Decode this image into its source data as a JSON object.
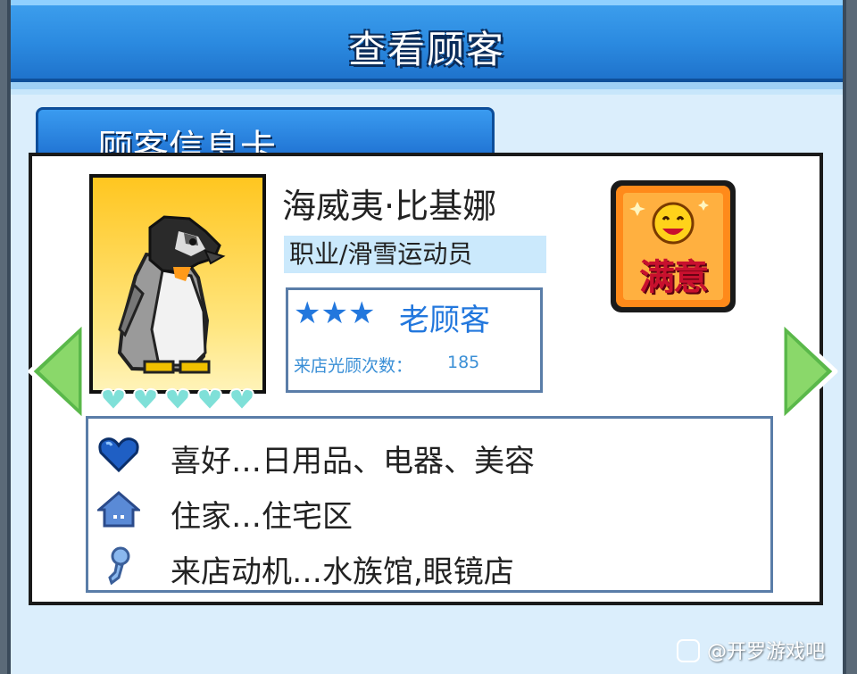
{
  "header": {
    "title": "查看顾客"
  },
  "tab": {
    "label": "顾客信息卡"
  },
  "customer": {
    "name": "海威夷·比基娜",
    "job": "职业/滑雪运动员",
    "stars": "★★★",
    "level": "老顾客",
    "visits_label": "来店光顾次数：",
    "visits_value": "185",
    "hearts_filled": 5,
    "hearts_total": 5,
    "satisfaction_badge": "满意"
  },
  "info": [
    {
      "icon": "heart-icon",
      "text": "喜好…日用品、电器、美容"
    },
    {
      "icon": "house-icon",
      "text": "住家…住宅区"
    },
    {
      "icon": "keyhole-icon",
      "text": "来店动机…水族馆,眼镜店"
    }
  ],
  "colors": {
    "title_bar": "#2b8ae0",
    "star_blue": "#2277dd",
    "arrow_green": "#5ab84a",
    "heart_teal": "#7fe0d8"
  },
  "watermark": {
    "text": "@开罗游戏吧"
  }
}
